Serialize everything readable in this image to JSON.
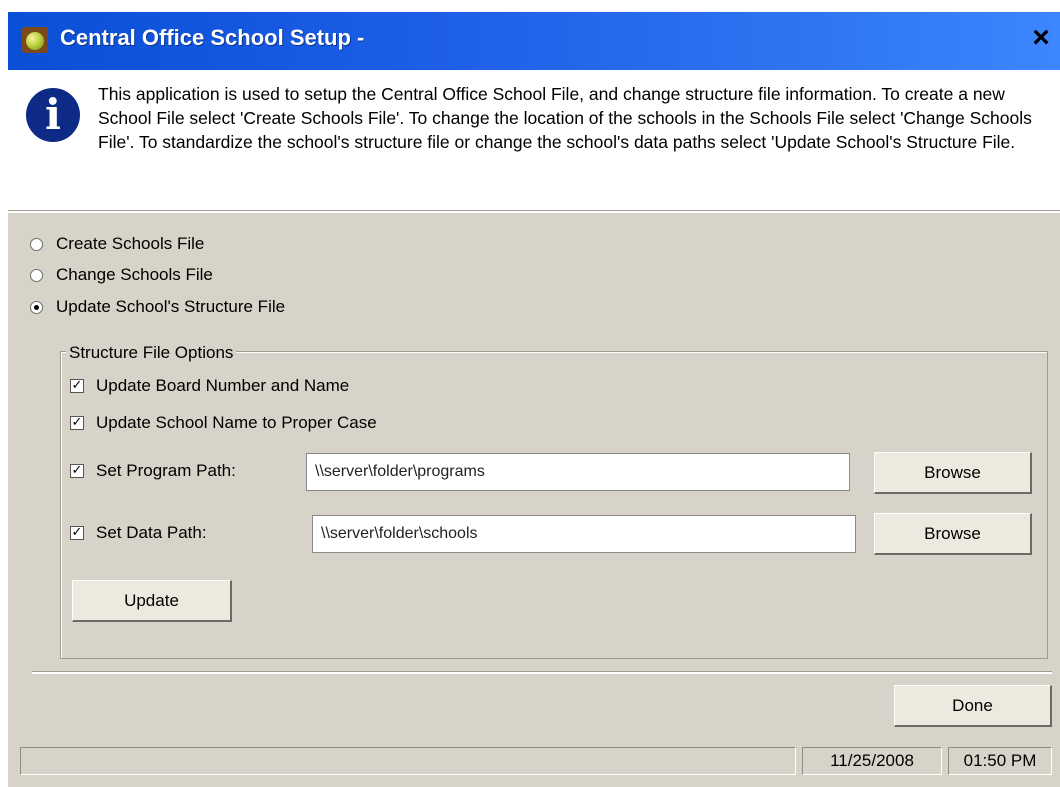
{
  "window": {
    "title": "Central Office School Setup -",
    "close_glyph": "×",
    "icon": "apple-icon"
  },
  "info": {
    "icon": "info-icon",
    "icon_glyph": "i",
    "text": "This application is used to setup the Central Office School File, and change structure file information. To create a new School File select 'Create Schools File'. To change the location of the schools in the Schools File select 'Change Schools File'. To standardize the school's structure file or change the school's data paths select 'Update School's Structure File."
  },
  "options": {
    "create_label": "Create Schools File",
    "change_label": "Change Schools File",
    "update_label": "Update School's Structure File",
    "selected": "update_label"
  },
  "structure": {
    "group_title": "Structure File Options",
    "update_board_label": "Update Board Number and Name",
    "update_board_checked": true,
    "proper_case_label": "Update School Name to Proper Case",
    "proper_case_checked": true,
    "program_path_label": "Set Program Path:",
    "program_path_checked": true,
    "program_path_value": "\\\\server\\folder\\programs",
    "data_path_label": "Set Data Path:",
    "data_path_checked": true,
    "data_path_value": "\\\\server\\folder\\schools",
    "browse_label": "Browse",
    "update_button_label": "Update"
  },
  "footer": {
    "done_label": "Done",
    "status_text": "",
    "date": "11/25/2008",
    "time": "01:50 PM"
  },
  "colors": {
    "titlebar": "#0a4fd6",
    "window_bg": "#d8d3c8",
    "info_icon": "#0c2a86"
  }
}
